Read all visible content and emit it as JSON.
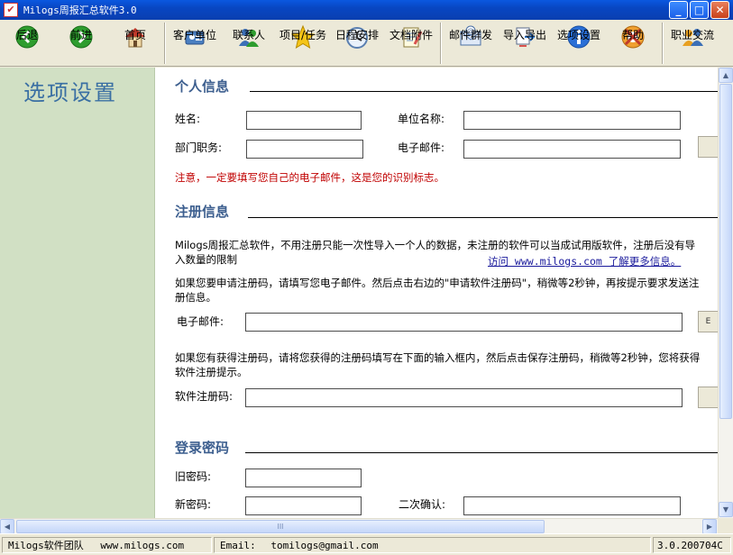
{
  "window": {
    "title": "Milogs周报汇总软件3.0",
    "min_glyph": "_",
    "max_glyph": "□",
    "close_glyph": "✕"
  },
  "toolbar": {
    "items": [
      {
        "label": "后退",
        "icon": "back-arrow-icon"
      },
      {
        "label": "前进",
        "icon": "forward-arrow-icon"
      },
      {
        "label": "首页",
        "icon": "home-icon"
      },
      {
        "label": "客户单位",
        "icon": "client-unit-icon"
      },
      {
        "label": "联系人",
        "icon": "contacts-icon"
      },
      {
        "label": "项目/任务",
        "icon": "star-icon"
      },
      {
        "label": "日程安排",
        "icon": "clock-icon"
      },
      {
        "label": "文档附件",
        "icon": "notepad-icon"
      },
      {
        "label": "邮件群发",
        "icon": "mail-icon"
      },
      {
        "label": "导入导出",
        "icon": "import-export-icon"
      },
      {
        "label": "选项设置",
        "icon": "info-icon"
      },
      {
        "label": "帮助",
        "icon": "help-icon"
      },
      {
        "label": "职业交流",
        "icon": "career-exchange-icon"
      }
    ]
  },
  "sidebar": {
    "heading": "选项设置"
  },
  "personal": {
    "section_title": "个人信息",
    "name_label": "姓名:",
    "name_value": "",
    "company_label": "单位名称:",
    "company_value": "",
    "dept_label": "部门职务:",
    "dept_value": "",
    "email_label": "电子邮件:",
    "email_value": "",
    "warning": "注意，一定要填写您自己的电子邮件，这是您的识别标志。"
  },
  "registration": {
    "section_title": "注册信息",
    "intro": "Milogs周报汇总软件，不用注册只能一次性导入一个人的数据，未注册的软件可以当成试用版软件，注册后没有导入数量的限制",
    "link_text": "访问 www.milogs.com 了解更多信息。",
    "apply_instructions": "如果您要申请注册码，请填写您电子邮件。然后点击右边的\"申请软件注册码\"，稍微等2秒钟，再按提示要求发送注册信息。",
    "email_label": "电子邮件:",
    "email_value": "",
    "email_button_fragment": "E",
    "code_instructions": "如果您有获得注册码，请将您获得的注册码填写在下面的输入框内，然后点击保存注册码，稍微等2秒钟，您将获得软件注册提示。",
    "code_label": "软件注册码:",
    "code_value": ""
  },
  "password": {
    "section_title": "登录密码",
    "old_label": "旧密码:",
    "old_value": "",
    "new_label": "新密码:",
    "new_value": "",
    "confirm_label": "二次确认:",
    "confirm_value": ""
  },
  "scrollbars": {
    "up_glyph": "▲",
    "down_glyph": "▼",
    "left_glyph": "◀",
    "right_glyph": "▶",
    "grip_glyph": "III"
  },
  "statusbar": {
    "team": "Milogs软件团队",
    "website": "www.milogs.com",
    "email_label": "Email:",
    "email": "tomilogs@gmail.com",
    "version": "3.0.200704C"
  }
}
